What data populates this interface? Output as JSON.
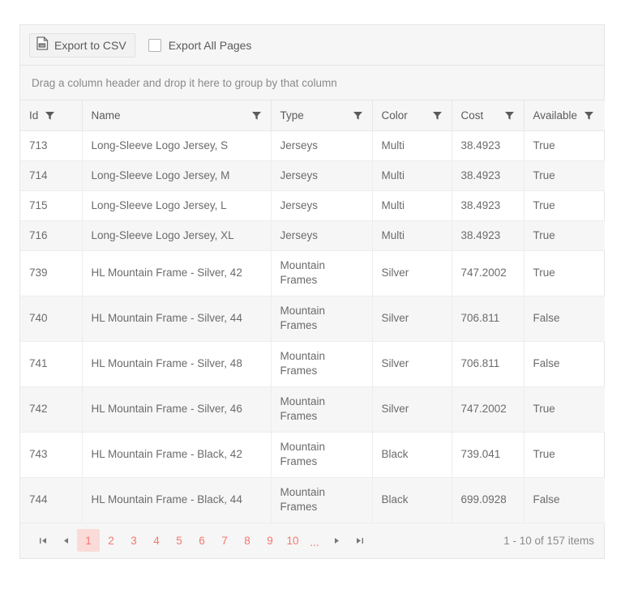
{
  "toolbar": {
    "export_button_label": "Export to CSV",
    "export_icon": "csv-file-icon",
    "export_all_pages_label": "Export All Pages",
    "export_all_pages_checked": false
  },
  "group_panel": {
    "hint": "Drag a column header and drop it here to group by that column"
  },
  "grid": {
    "columns": [
      {
        "key": "id",
        "label": "Id",
        "filter_icon": "filter-icon"
      },
      {
        "key": "name",
        "label": "Name",
        "filter_icon": "filter-icon"
      },
      {
        "key": "type",
        "label": "Type",
        "filter_icon": "filter-icon"
      },
      {
        "key": "color",
        "label": "Color",
        "filter_icon": "filter-icon"
      },
      {
        "key": "cost",
        "label": "Cost",
        "filter_icon": "filter-icon"
      },
      {
        "key": "available",
        "label": "Available",
        "filter_icon": "filter-icon"
      }
    ],
    "rows": [
      {
        "id": "713",
        "name": "Long-Sleeve Logo Jersey, S",
        "type": "Jerseys",
        "color": "Multi",
        "cost": "38.4923",
        "available": "True"
      },
      {
        "id": "714",
        "name": "Long-Sleeve Logo Jersey, M",
        "type": "Jerseys",
        "color": "Multi",
        "cost": "38.4923",
        "available": "True"
      },
      {
        "id": "715",
        "name": "Long-Sleeve Logo Jersey, L",
        "type": "Jerseys",
        "color": "Multi",
        "cost": "38.4923",
        "available": "True"
      },
      {
        "id": "716",
        "name": "Long-Sleeve Logo Jersey, XL",
        "type": "Jerseys",
        "color": "Multi",
        "cost": "38.4923",
        "available": "True"
      },
      {
        "id": "739",
        "name": "HL Mountain Frame - Silver, 42",
        "type": "Mountain Frames",
        "color": "Silver",
        "cost": "747.2002",
        "available": "True"
      },
      {
        "id": "740",
        "name": "HL Mountain Frame - Silver, 44",
        "type": "Mountain Frames",
        "color": "Silver",
        "cost": "706.811",
        "available": "False"
      },
      {
        "id": "741",
        "name": "HL Mountain Frame - Silver, 48",
        "type": "Mountain Frames",
        "color": "Silver",
        "cost": "706.811",
        "available": "False"
      },
      {
        "id": "742",
        "name": "HL Mountain Frame - Silver, 46",
        "type": "Mountain Frames",
        "color": "Silver",
        "cost": "747.2002",
        "available": "True"
      },
      {
        "id": "743",
        "name": "HL Mountain Frame - Black, 42",
        "type": "Mountain Frames",
        "color": "Black",
        "cost": "739.041",
        "available": "True"
      },
      {
        "id": "744",
        "name": "HL Mountain Frame - Black, 44",
        "type": "Mountain Frames",
        "color": "Black",
        "cost": "699.0928",
        "available": "False"
      }
    ]
  },
  "pager": {
    "first_icon": "go-to-first-page-icon",
    "prev_icon": "previous-page-icon",
    "next_icon": "next-page-icon",
    "last_icon": "go-to-last-page-icon",
    "pages": [
      "1",
      "2",
      "3",
      "4",
      "5",
      "6",
      "7",
      "8",
      "9",
      "10"
    ],
    "ellipsis": "...",
    "selected_page": "1",
    "info": "1 - 10 of 157 items"
  },
  "colors": {
    "accent": "#f4776e",
    "accent_bg": "#fadbd8",
    "panel_bg": "#f6f6f6",
    "border": "#e6e6e6",
    "text": "#6b6b6b"
  }
}
